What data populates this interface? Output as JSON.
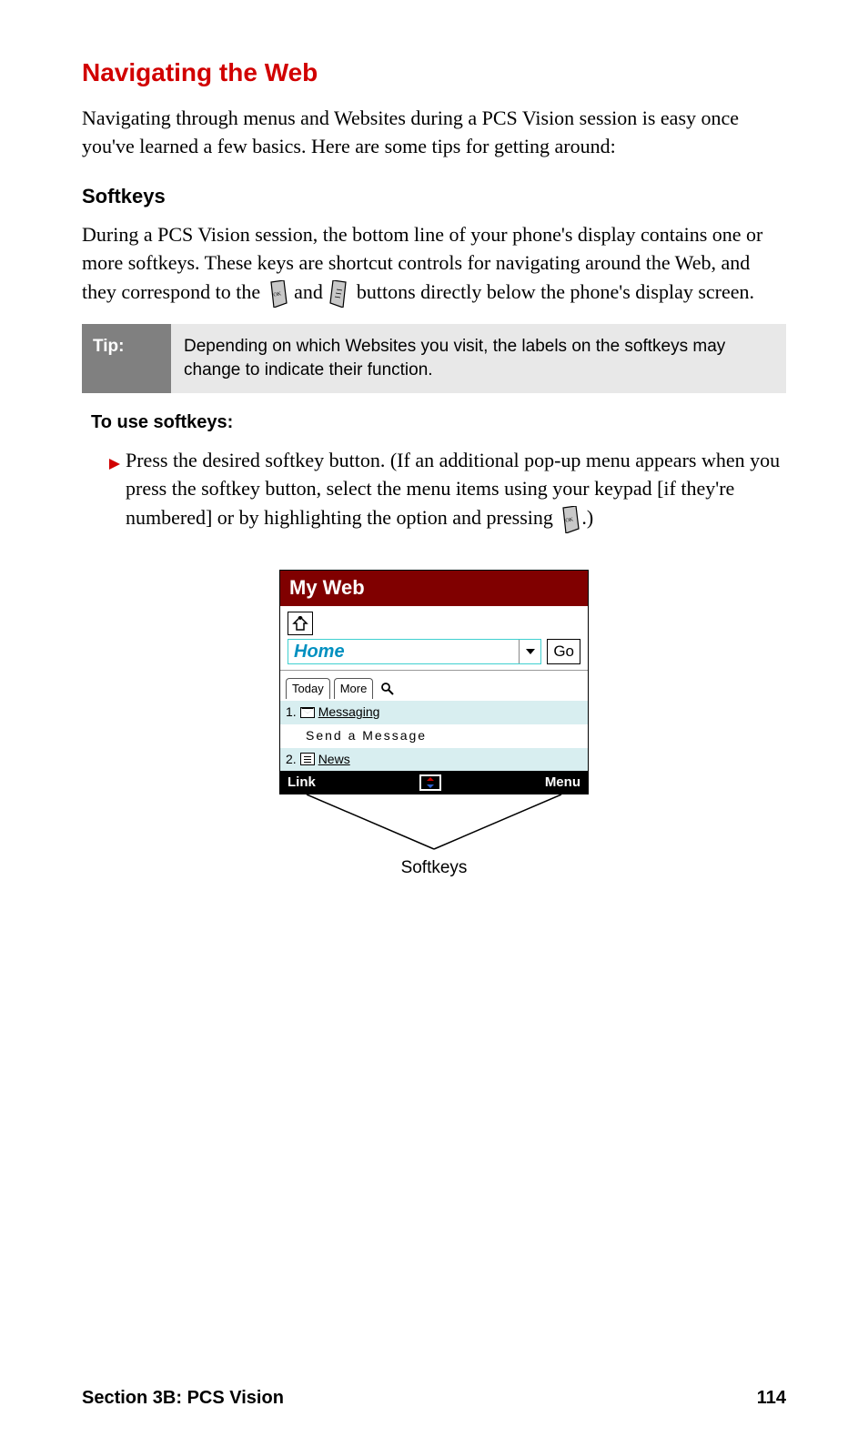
{
  "title": "Navigating the Web",
  "intro": "Navigating through menus and Websites during a PCS Vision session is easy once you've learned a few basics. Here are some tips for getting around:",
  "softkeys": {
    "heading": "Softkeys",
    "para_a": "During a PCS Vision session, the bottom line of your phone's display contains one or more softkeys. These keys are shortcut controls for navigating around the Web, and they correspond to the ",
    "para_b": " and ",
    "para_c": " buttons directly below the phone's display screen."
  },
  "tip": {
    "label": "Tip:",
    "text": "Depending on which Websites you visit, the labels on the softkeys may change to indicate their function."
  },
  "instr": {
    "heading": "To use softkeys:",
    "text_a": "Press the desired softkey button. (If an additional pop-up menu appears when you press the softkey button, select the menu items using your keypad [if they're numbered] or by highlighting the option and pressing ",
    "text_b": ".)"
  },
  "phone": {
    "title": "My Web",
    "addr": "Home",
    "go": "Go",
    "tabs": {
      "today": "Today",
      "more": "More"
    },
    "items": {
      "msg_num": "1.",
      "msg_label": "Messaging",
      "msg_sub": "Send a Message",
      "news_num": "2.",
      "news_label": "News"
    },
    "softbar": {
      "left": "Link",
      "right": "Menu"
    },
    "callout": "Softkeys"
  },
  "footer": {
    "section": "Section 3B: PCS Vision",
    "page": "114"
  }
}
